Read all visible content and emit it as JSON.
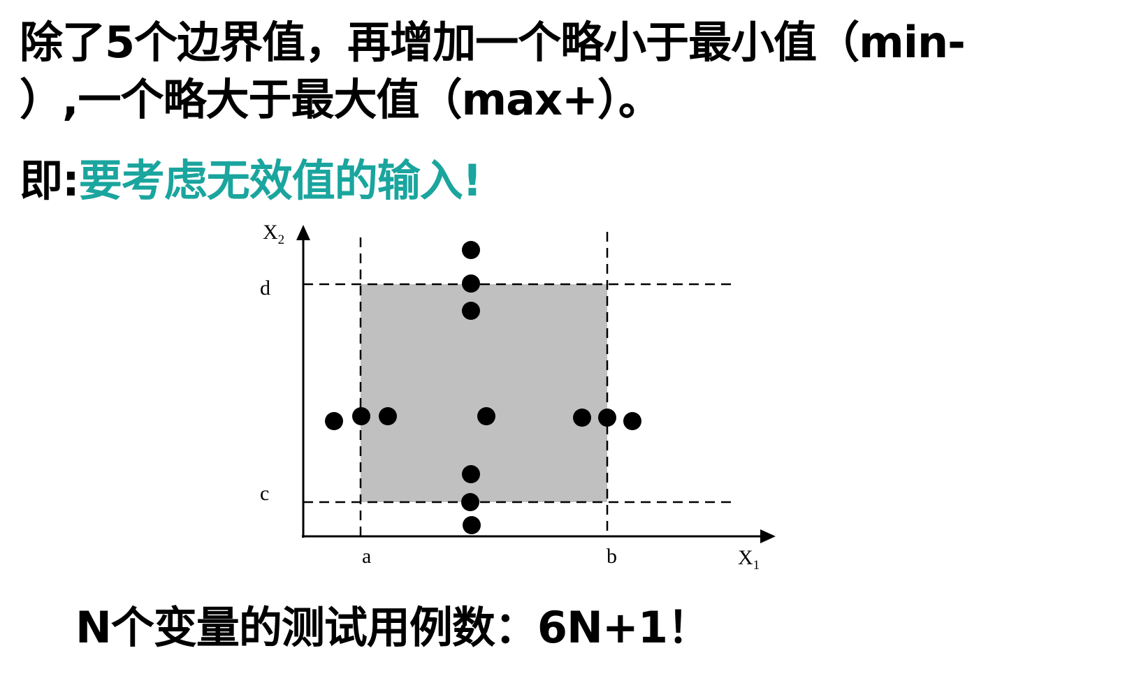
{
  "heading": {
    "line1": "除了5个边界值，再增加一个略小于最小值（min-",
    "line2": "）,一个略大于最大值（max+）。"
  },
  "subheading": {
    "prefix": "即:",
    "emphasis": "要考虑无效值的输入!",
    "emphasis_color": "#1aa59e"
  },
  "diagram": {
    "x_axis_label": "X",
    "x_axis_subscript": "1",
    "y_axis_label": "X",
    "y_axis_subscript": "2",
    "x_bounds": {
      "low": "a",
      "high": "b"
    },
    "y_bounds": {
      "low": "c",
      "high": "d"
    },
    "valid_region_color": "#c0c0c0",
    "test_points": [
      {
        "x1": "nom",
        "x2": "max+"
      },
      {
        "x1": "nom",
        "x2": "max"
      },
      {
        "x1": "nom",
        "x2": "max-"
      },
      {
        "x1": "min-",
        "x2": "nom"
      },
      {
        "x1": "min",
        "x2": "nom"
      },
      {
        "x1": "min+",
        "x2": "nom"
      },
      {
        "x1": "nom",
        "x2": "nom"
      },
      {
        "x1": "max-",
        "x2": "nom"
      },
      {
        "x1": "max",
        "x2": "nom"
      },
      {
        "x1": "max+",
        "x2": "nom"
      },
      {
        "x1": "nom",
        "x2": "min+"
      },
      {
        "x1": "nom",
        "x2": "min"
      },
      {
        "x1": "nom",
        "x2": "min-"
      }
    ]
  },
  "footer": {
    "text": "N个变量的测试用例数：6N+1！"
  }
}
